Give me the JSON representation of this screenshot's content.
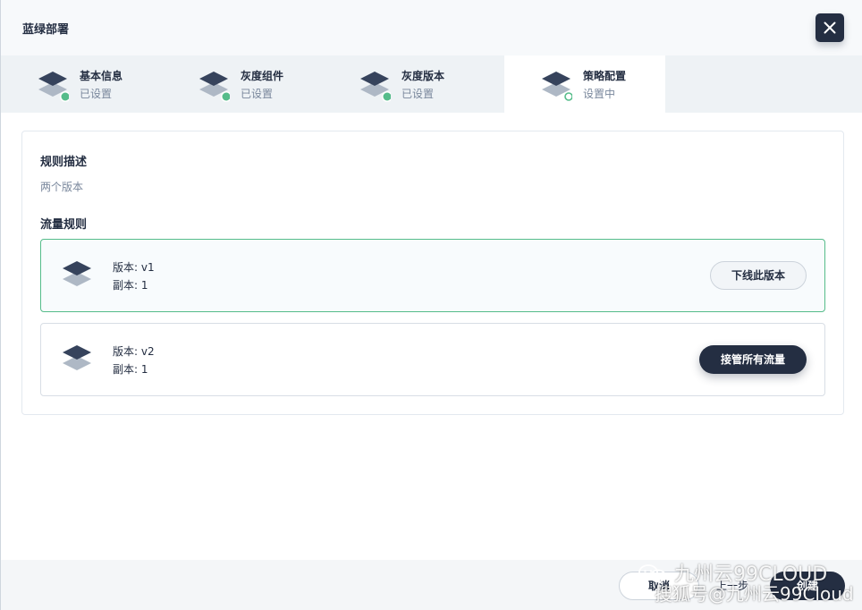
{
  "modal": {
    "title": "蓝绿部署"
  },
  "steps": [
    {
      "label": "基本信息",
      "status": "已设置",
      "state": "done"
    },
    {
      "label": "灰度组件",
      "status": "已设置",
      "state": "done"
    },
    {
      "label": "灰度版本",
      "status": "已设置",
      "state": "done"
    },
    {
      "label": "策略配置",
      "status": "设置中",
      "state": "current"
    }
  ],
  "rule": {
    "title": "规则描述",
    "description": "两个版本"
  },
  "traffic": {
    "title": "流量规则",
    "versions": [
      {
        "version": "版本: v1",
        "replicas": "副本: 1",
        "action": "下线此版本",
        "selected": true
      },
      {
        "version": "版本: v2",
        "replicas": "副本: 1",
        "action": "接管所有流量",
        "selected": false
      }
    ]
  },
  "footer": {
    "cancel": "取消",
    "prev": "上一步",
    "create": "创建"
  },
  "watermark": {
    "line1": "九州云99CLOUD",
    "line2": "搜狐号@九州云99Cloud"
  },
  "colors": {
    "dark": "#242e42",
    "success": "#55bc8a",
    "muted": "#79879c"
  }
}
